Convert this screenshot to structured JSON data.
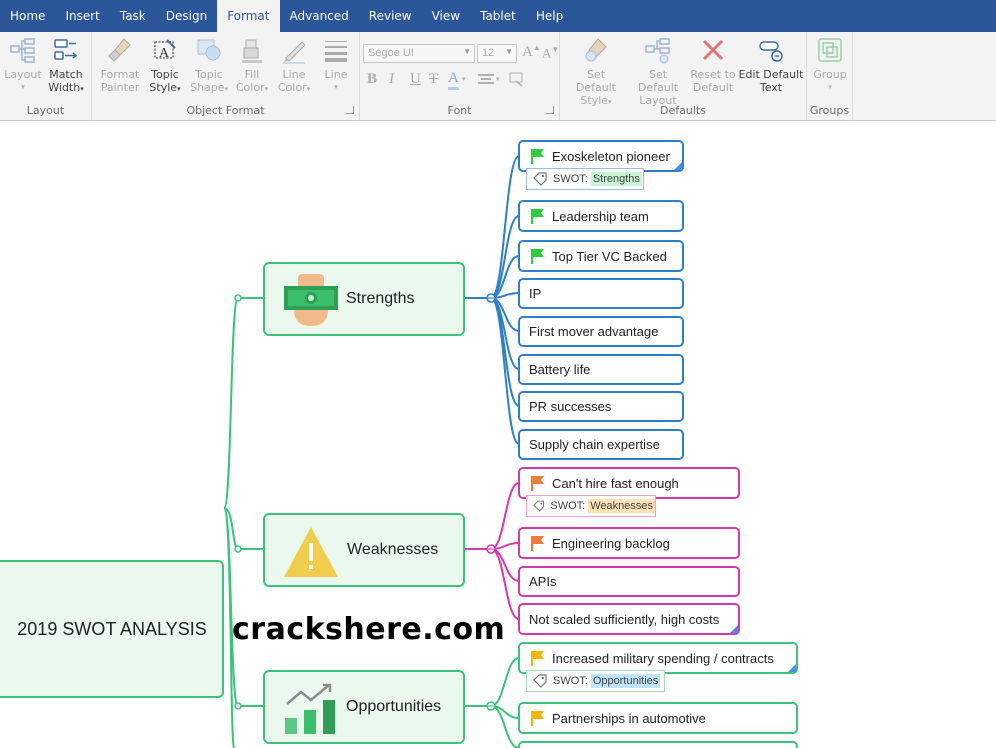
{
  "tabs": [
    "Home",
    "Insert",
    "Task",
    "Design",
    "Format",
    "Advanced",
    "Review",
    "View",
    "Tablet",
    "Help"
  ],
  "active_tab": "Format",
  "ribbon": {
    "layout_group": {
      "label": "Layout",
      "buttons": [
        {
          "line1": "Layout",
          "line2": ""
        },
        {
          "line1": "Match",
          "line2": "Width"
        }
      ]
    },
    "object_format_group": {
      "label": "Object Format",
      "buttons": [
        {
          "line1": "Format",
          "line2": "Painter"
        },
        {
          "line1": "Topic",
          "line2": "Style"
        },
        {
          "line1": "Topic",
          "line2": "Shape"
        },
        {
          "line1": "Fill",
          "line2": "Color"
        },
        {
          "line1": "Line",
          "line2": "Color"
        },
        {
          "line1": "Line",
          "line2": ""
        }
      ]
    },
    "font_group": {
      "label": "Font",
      "font_name": "Segoe UI",
      "font_size": "12",
      "buttons": [
        "B",
        "I",
        "U",
        "T"
      ]
    },
    "defaults_group": {
      "label": "Defaults",
      "buttons": [
        {
          "line1": "Set Default",
          "line2": "Style"
        },
        {
          "line1": "Set Default",
          "line2": "Layout"
        },
        {
          "line1": "Reset to",
          "line2": "Default"
        },
        {
          "line1": "Edit Default",
          "line2": "Text"
        }
      ]
    },
    "groups_group": {
      "label": "Groups",
      "buttons": [
        {
          "line1": "Group",
          "line2": ""
        }
      ]
    }
  },
  "map": {
    "central": "2019 SWOT ANALYSIS",
    "categories": [
      {
        "label": "Strengths",
        "icon": "money-hand-icon"
      },
      {
        "label": "Weaknesses",
        "icon": "warning-icon"
      },
      {
        "label": "Opportunities",
        "icon": "growth-chart-icon"
      }
    ],
    "strengths": [
      "Exoskeleton pioneer",
      "Leadership team",
      "Top Tier VC Backed",
      "IP",
      "First mover advantage",
      "Battery life",
      "PR successes",
      "Supply chain expertise"
    ],
    "weaknesses": [
      "Can't hire fast enough",
      "Engineering backlog",
      "APIs",
      "Not scaled sufficiently, high costs"
    ],
    "opportunities": [
      "Increased military spending / contracts",
      "Partnerships in automotive"
    ],
    "tags": {
      "prefix": "SWOT:",
      "strengths": "Strengths",
      "weaknesses": "Weaknesses",
      "opportunities": "Opportunities"
    }
  },
  "colors": {
    "ribbon_blue": "#2b579a",
    "strength_line": "#2e7fc7",
    "weakness_line": "#d63aa8",
    "opportunity_line": "#3cc27a",
    "flag_green": "#2ecc40",
    "flag_orange": "#f07a3a",
    "flag_yellow": "#f5b400"
  },
  "watermark": "crackshere.com"
}
